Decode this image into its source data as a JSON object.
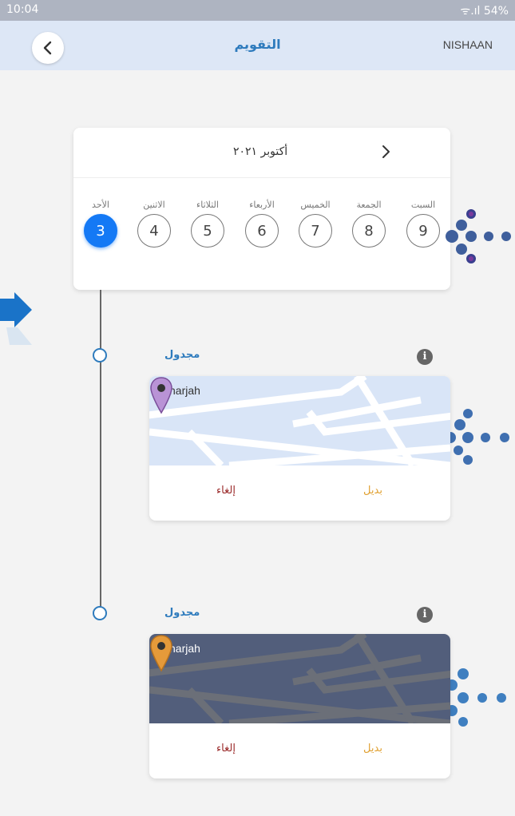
{
  "status_bar": {
    "time": "10:04",
    "right": "ᯤ.ıl 54%"
  },
  "header": {
    "title": "التقويم",
    "user": "NISHAAN"
  },
  "calendar": {
    "month": "أكتوبر ٢٠٢١",
    "days": [
      {
        "name": "السبت",
        "num": "9"
      },
      {
        "name": "الجمعة",
        "num": "8"
      },
      {
        "name": "الخميس",
        "num": "7"
      },
      {
        "name": "الأربعاء",
        "num": "6"
      },
      {
        "name": "الثلاثاء",
        "num": "5"
      },
      {
        "name": "الاثنين",
        "num": "4"
      },
      {
        "name": "الأحد",
        "num": "3"
      }
    ]
  },
  "events": [
    {
      "status": "مجدول",
      "location": "sharjah",
      "cancel": "إلغاء",
      "alternative": "بديل",
      "map_bg": "#d9e5f7",
      "pin_color": "#b993d6"
    },
    {
      "status": "مجدول",
      "location": "sharjah",
      "cancel": "إلغاء",
      "alternative": "بديل",
      "map_bg": "#525e7b",
      "pin_color": "#e59a3a"
    }
  ],
  "colors": {
    "accent": "#2e7bbd",
    "selected_day": "#1479f5",
    "cancel": "#9b2c2c",
    "alternative": "#e0a030"
  }
}
